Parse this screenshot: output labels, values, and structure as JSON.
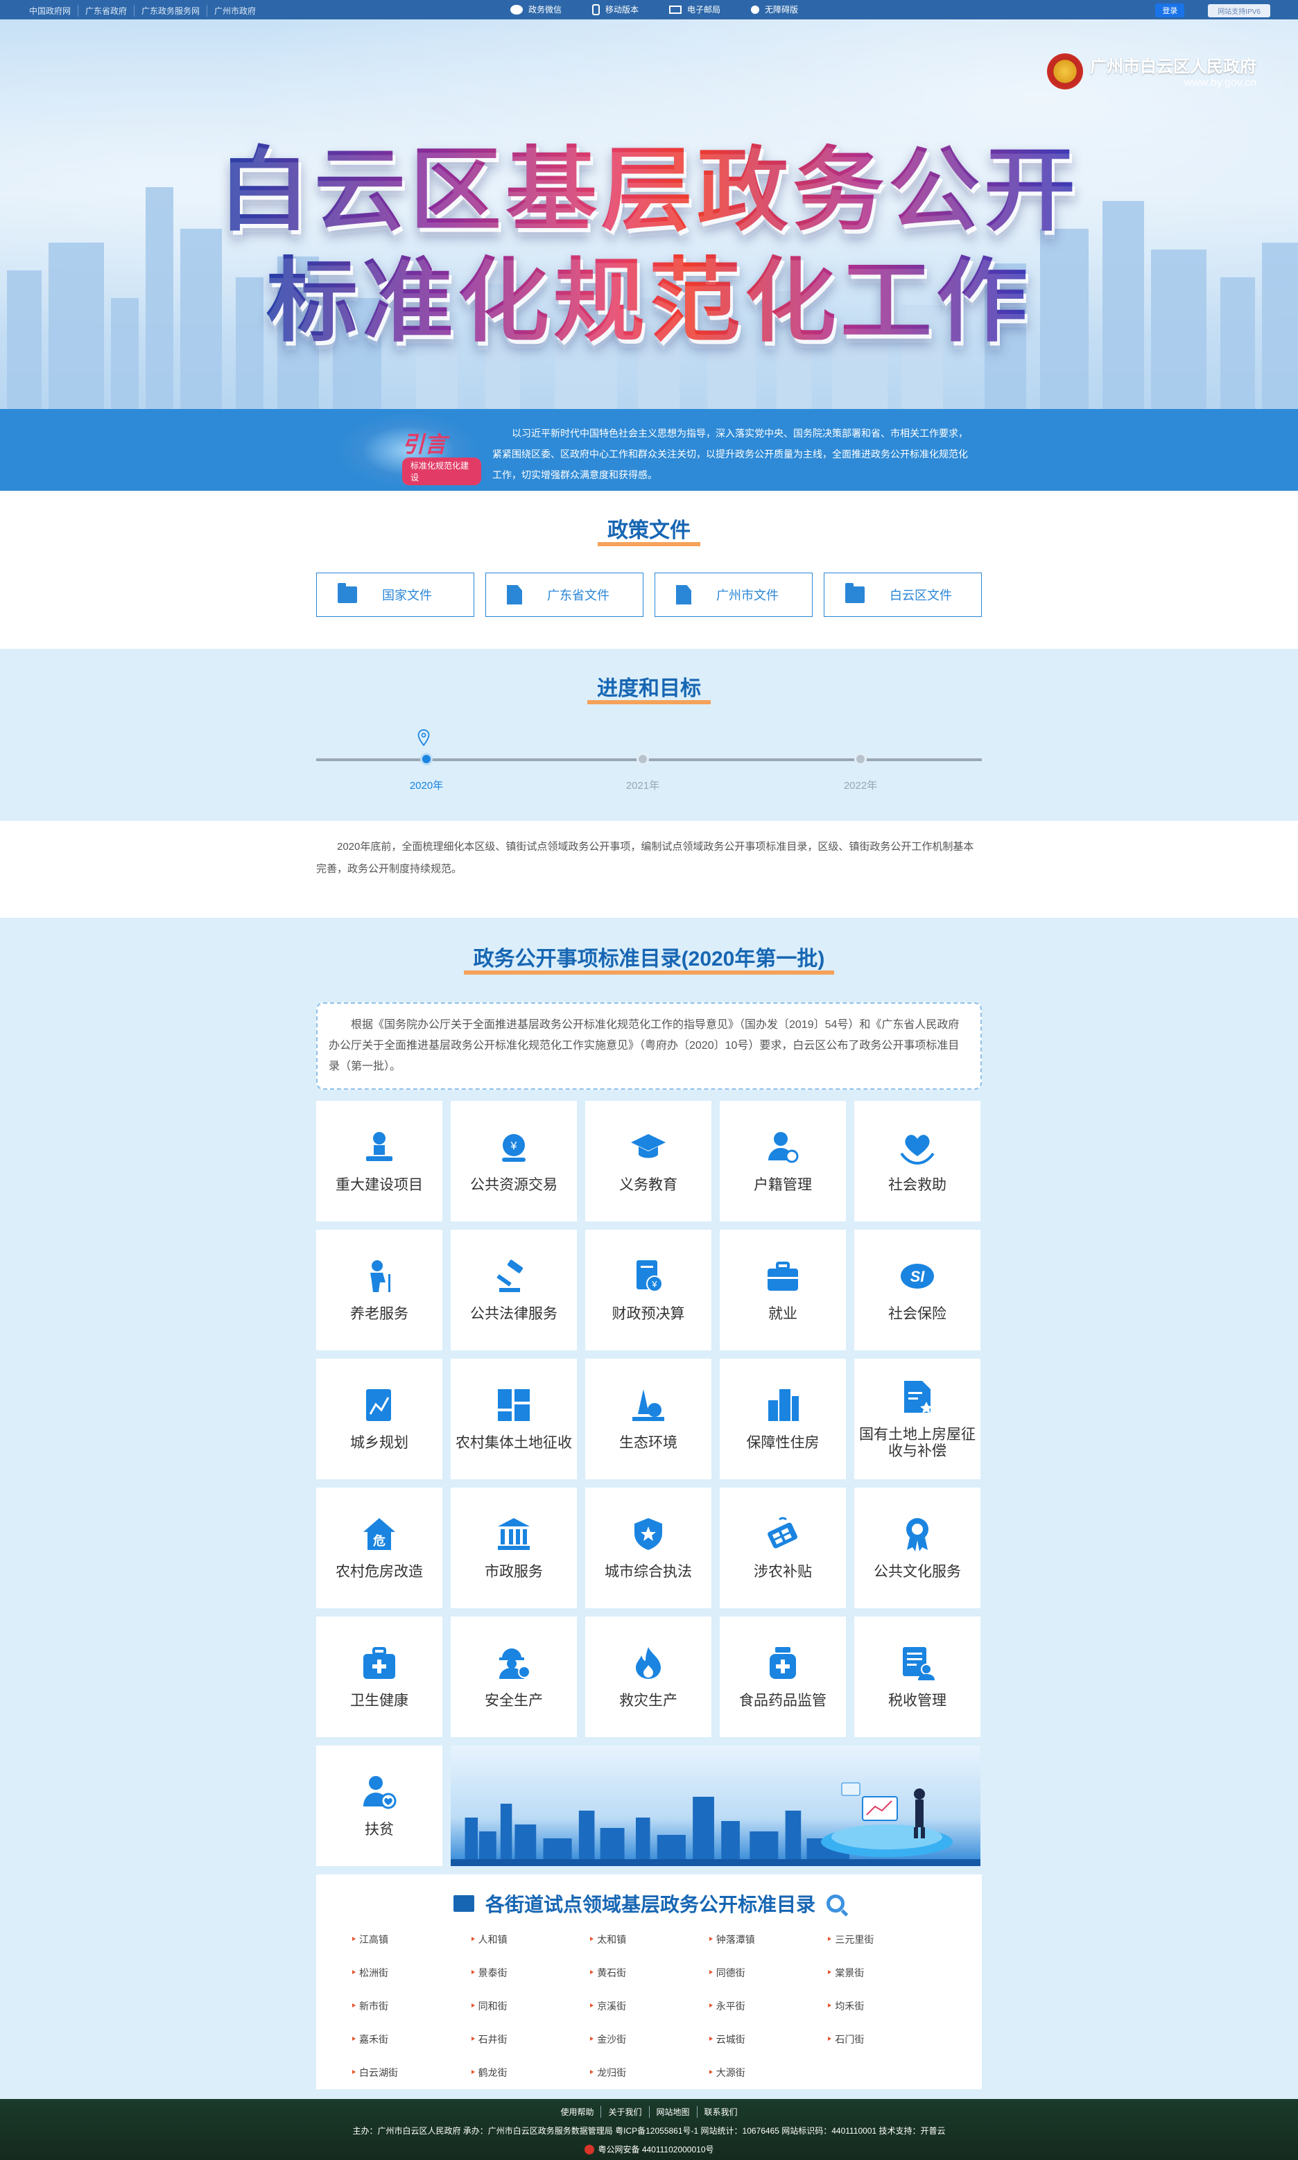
{
  "topbar": {
    "left_links": [
      "中国政府网",
      "广东省政府",
      "广东政务服务网",
      "广州市政府"
    ],
    "mid_links": [
      {
        "label": "政务微信",
        "icon": "wechat-icon"
      },
      {
        "label": "移动版本",
        "icon": "mobile-icon"
      },
      {
        "label": "电子邮局",
        "icon": "mail-icon"
      },
      {
        "label": "无障碍版",
        "icon": "accessibility-icon"
      }
    ],
    "login": "登录",
    "ipv6": "网站支持IPV6"
  },
  "banner": {
    "title_line1": "白云区基层政务公开",
    "title_line2": "标准化规范化工作",
    "gov_name": "广州市白云区人民政府",
    "gov_url": "www.by.gov.cn"
  },
  "intro": {
    "badge_title": "引言",
    "badge_tag": "标准化规范化建设",
    "text": "以习近平新时代中国特色社会主义思想为指导，深入落实党中央、国务院决策部署和省、市相关工作要求，紧紧围绕区委、区政府中心工作和群众关注关切，以提升政务公开质量为主线，全面推进政务公开标准化规范化工作，切实增强群众满意度和获得感。"
  },
  "policy": {
    "title": "政策文件",
    "buttons": [
      {
        "label": "国家文件",
        "icon": "folder-icon"
      },
      {
        "label": "广东省文件",
        "icon": "document-icon"
      },
      {
        "label": "广州市文件",
        "icon": "document-icon"
      },
      {
        "label": "白云区文件",
        "icon": "folder-open-icon"
      }
    ]
  },
  "progress": {
    "title": "进度和目标",
    "years": [
      {
        "label": "2020年",
        "active": true
      },
      {
        "label": "2021年",
        "active": false
      },
      {
        "label": "2022年",
        "active": false
      }
    ],
    "goal_text": "2020年底前，全面梳理细化本区级、镇街试点领域政务公开事项，编制试点领域政务公开事项标准目录，区级、镇街政务公开工作机制基本完善，政务公开制度持续规范。"
  },
  "catalog": {
    "title": "政务公开事项标准目录(2020年第一批)",
    "notice": "根据《国务院办公厅关于全面推进基层政务公开标准化规范化工作的指导意见》（国办发〔2019〕54号）和《广东省人民政府办公厅关于全面推进基层政务公开标准化规范化工作实施意见》（粤府办〔2020〕10号）要求，白云区公布了政务公开事项标准目录（第一批）。",
    "items": [
      {
        "label": "重大建设项目",
        "icon": "construction-icon"
      },
      {
        "label": "公共资源交易",
        "icon": "trade-icon"
      },
      {
        "label": "义务教育",
        "icon": "graduation-cap-icon"
      },
      {
        "label": "户籍管理",
        "icon": "user-edit-icon"
      },
      {
        "label": "社会救助",
        "icon": "heart-hands-icon"
      },
      {
        "label": "养老服务",
        "icon": "elderly-icon"
      },
      {
        "label": "公共法律服务",
        "icon": "gavel-icon"
      },
      {
        "label": "财政预决算",
        "icon": "budget-icon"
      },
      {
        "label": "就业",
        "icon": "briefcase-icon"
      },
      {
        "label": "社会保险",
        "icon": "social-insurance-icon"
      },
      {
        "label": "城乡规划",
        "icon": "planning-icon"
      },
      {
        "label": "农村集体土地征收",
        "icon": "land-icon"
      },
      {
        "label": "生态环境",
        "icon": "ecology-icon"
      },
      {
        "label": "保障性住房",
        "icon": "housing-icon"
      },
      {
        "label": "国有土地上房屋征收与补偿",
        "icon": "house-document-icon"
      },
      {
        "label": "农村危房改造",
        "icon": "danger-house-icon"
      },
      {
        "label": "市政服务",
        "icon": "government-building-icon"
      },
      {
        "label": "城市综合执法",
        "icon": "shield-icon"
      },
      {
        "label": "涉农补贴",
        "icon": "farm-icon"
      },
      {
        "label": "公共文化服务",
        "icon": "culture-badge-icon"
      },
      {
        "label": "卫生健康",
        "icon": "medical-kit-icon"
      },
      {
        "label": "安全生产",
        "icon": "worker-helmet-icon"
      },
      {
        "label": "救灾生产",
        "icon": "fire-icon"
      },
      {
        "label": "食品药品监管",
        "icon": "medicine-bottle-icon"
      },
      {
        "label": "税收管理",
        "icon": "tax-icon"
      },
      {
        "label": "扶贫",
        "icon": "poverty-aid-icon"
      }
    ]
  },
  "streets": {
    "title": "各街道试点领域基层政务公开标准目录",
    "list": [
      "江高镇",
      "人和镇",
      "太和镇",
      "钟落潭镇",
      "三元里街",
      "松洲街",
      "景泰街",
      "黄石街",
      "同德街",
      "棠景街",
      "新市街",
      "同和街",
      "京溪街",
      "永平街",
      "均禾街",
      "嘉禾街",
      "石井街",
      "金沙街",
      "云城街",
      "石门街",
      "白云湖街",
      "鹤龙街",
      "龙归街",
      "大源街"
    ]
  },
  "footer": {
    "links": [
      "使用帮助",
      "关于我们",
      "网站地图",
      "联系我们"
    ],
    "host": "主办：广州市白云区人民政府  承办：广州市白云区政务服务数据管理局  粤ICP备12055861号-1  网站统计：10676465  网站标识码：4401110001  技术支持：开普云",
    "police": "粤公网安备 44011102000010号"
  },
  "colors": {
    "primary": "#1766b3",
    "accent_orange": "#f5a25a",
    "light_bg": "#dbeefa",
    "topbar": "#2d67a9"
  }
}
